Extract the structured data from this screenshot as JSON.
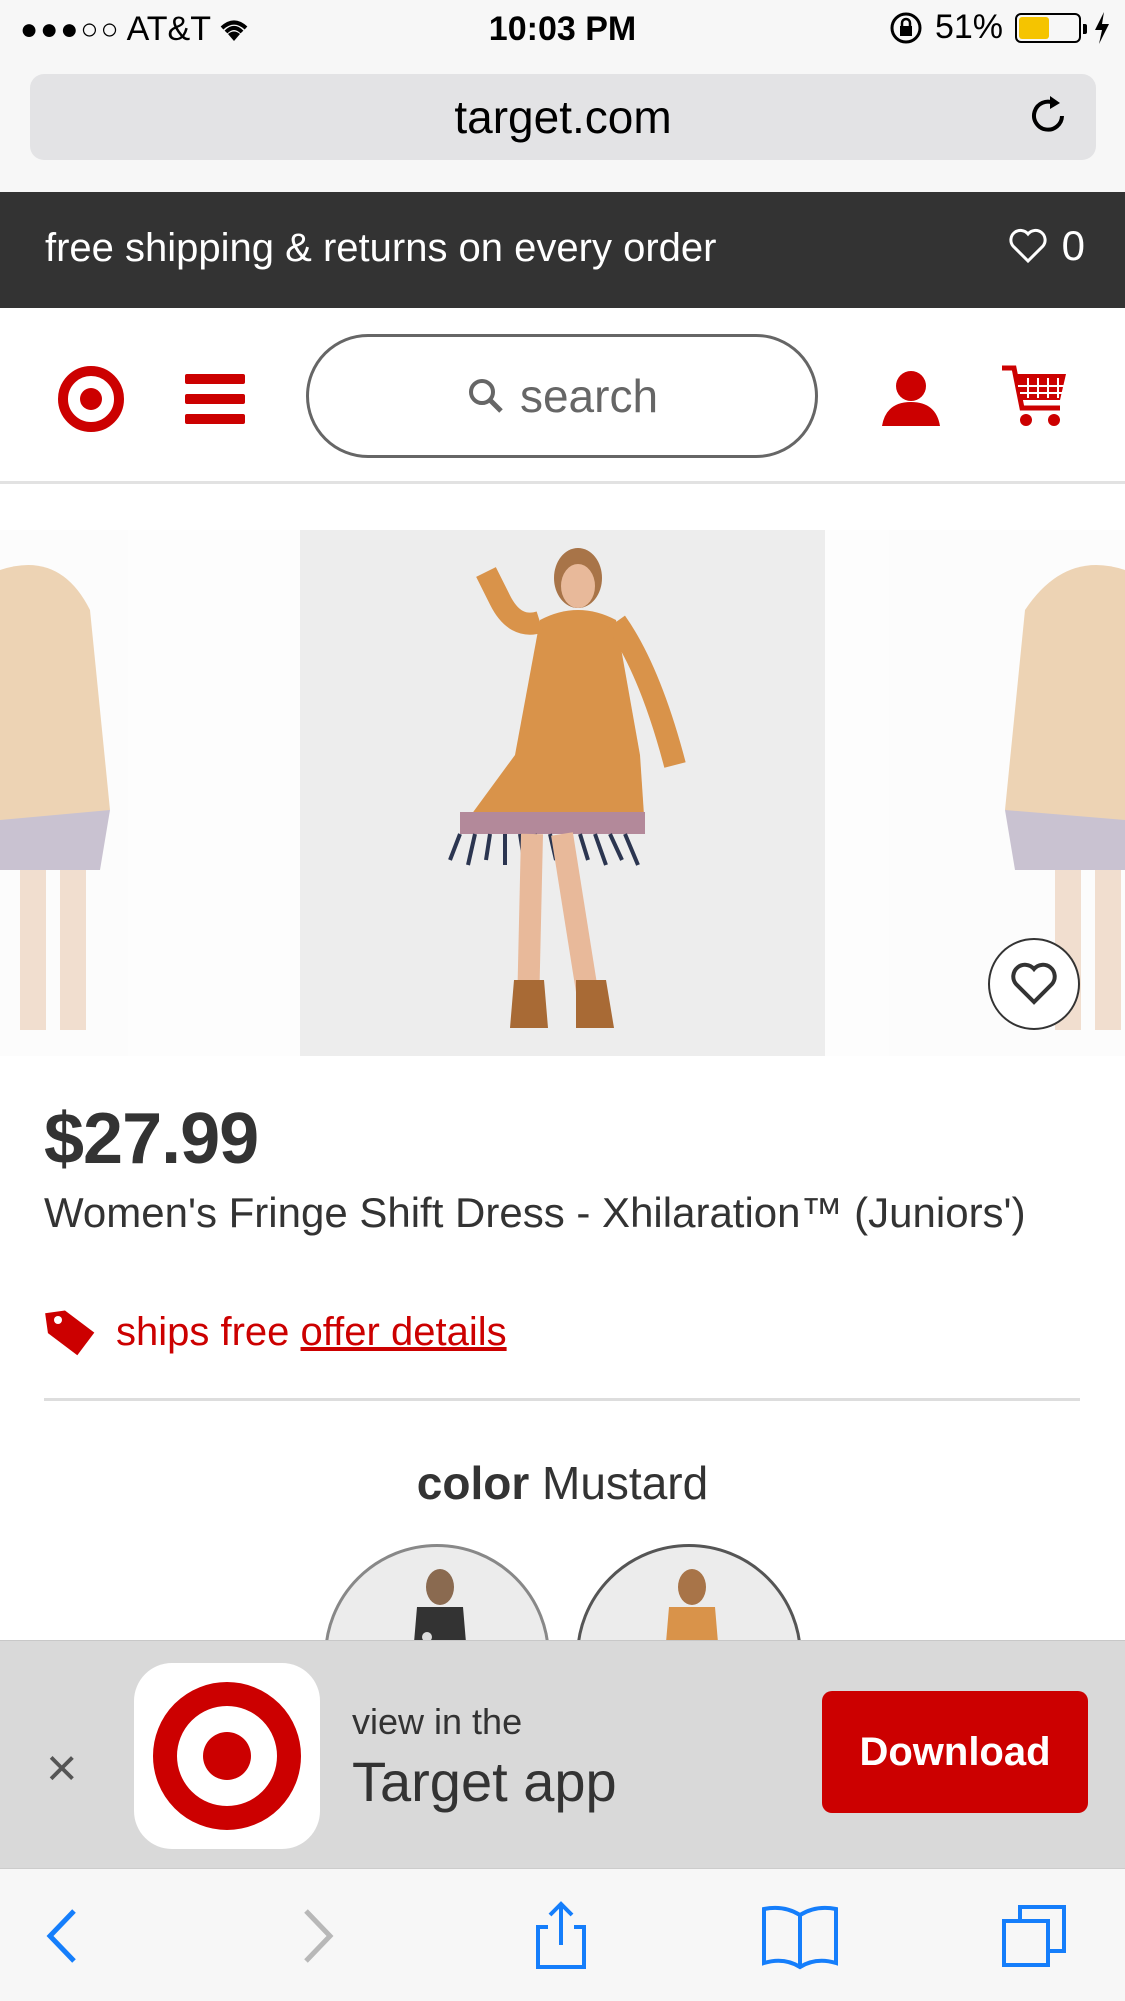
{
  "status_bar": {
    "carrier": "AT&T",
    "time": "10:03 PM",
    "battery": "51%",
    "battery_level": 0.51
  },
  "browser": {
    "url": "target.com"
  },
  "promo": {
    "text": "free shipping & returns on every order",
    "favorites_count": "0"
  },
  "header": {
    "search_placeholder": "search"
  },
  "product": {
    "price": "$27.99",
    "title": "Women's Fringe Shift Dress - Xhilaration™ (Juniors')",
    "ships_free": "ships free",
    "offer_details": "offer details",
    "color_label": "color",
    "color_value": "Mustard"
  },
  "app_banner": {
    "line1": "view in the",
    "line2": "Target app",
    "download_label": "Download",
    "close_glyph": "×"
  },
  "colors": {
    "brand_red": "#cc0000",
    "promo_bg": "#333333",
    "ios_blue": "#157efb"
  },
  "icons": [
    "wifi-icon",
    "rotation-lock-icon",
    "charging-icon",
    "reload-icon",
    "heart-icon",
    "target-logo-icon",
    "menu-icon",
    "search-icon",
    "account-icon",
    "cart-icon",
    "tag-icon",
    "close-icon",
    "back-icon",
    "forward-icon",
    "share-icon",
    "bookmarks-icon",
    "tabs-icon"
  ]
}
